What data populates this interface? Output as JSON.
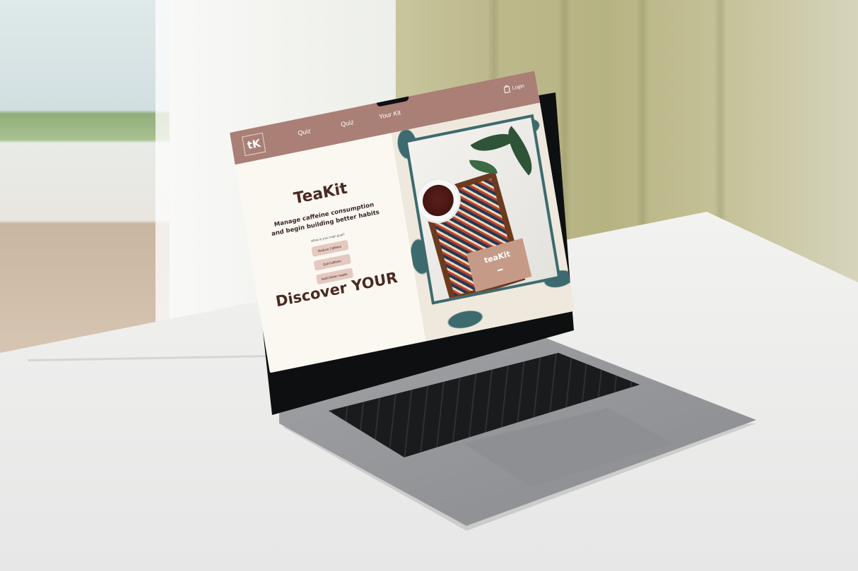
{
  "site": {
    "logo_text": "tK",
    "nav": [
      "Quiz",
      "Quiz",
      "Your Kit"
    ],
    "login_label": "Login"
  },
  "hero": {
    "brand": "TeaKit",
    "tagline": "Manage caffeine consumption and begin building better habits",
    "question": "What is your main goal?",
    "goals": [
      "Reduce Caffeine",
      "Quit Caffeine",
      "Build Better Habits"
    ],
    "section_heading": "Discover YOUR"
  },
  "product_box": {
    "title": "teaKit"
  },
  "colors": {
    "brand_rose": "#a97f76",
    "button_pink": "#e5c9c0",
    "teal_pattern": "#3d6a6e",
    "cream": "#fbf8f2",
    "text_brown": "#4a2a22"
  },
  "icons": [
    "shopping-bag-icon"
  ]
}
